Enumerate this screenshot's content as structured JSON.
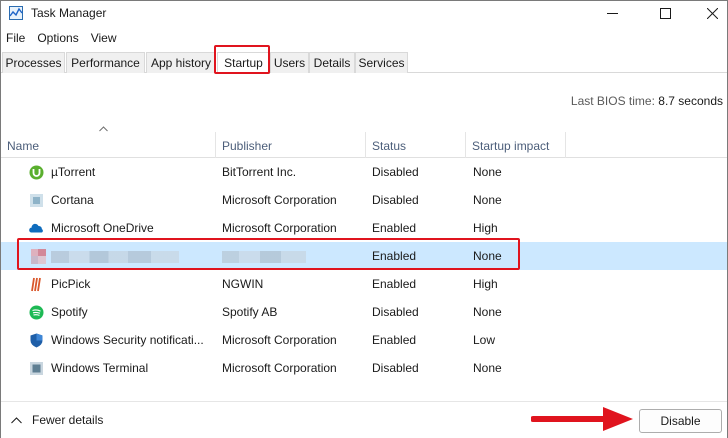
{
  "window": {
    "title": "Task Manager",
    "controls": {
      "minimize": "minimize-icon",
      "maximize": "maximize-icon",
      "close": "close-icon"
    }
  },
  "menu": [
    "File",
    "Options",
    "View"
  ],
  "tabs": [
    {
      "label": "Processes",
      "active": false
    },
    {
      "label": "Performance",
      "active": false
    },
    {
      "label": "App history",
      "active": false
    },
    {
      "label": "Startup",
      "active": true
    },
    {
      "label": "Users",
      "active": false
    },
    {
      "label": "Details",
      "active": false
    },
    {
      "label": "Services",
      "active": false
    }
  ],
  "bios": {
    "label": "Last BIOS time:",
    "value": "8.7 seconds"
  },
  "table": {
    "columns": [
      "Name",
      "Publisher",
      "Status",
      "Startup impact"
    ],
    "rows": [
      {
        "name": "µTorrent",
        "publisher": "BitTorrent Inc.",
        "status": "Disabled",
        "impact": "None",
        "icon": "utorrent-icon"
      },
      {
        "name": "Cortana",
        "publisher": "Microsoft Corporation",
        "status": "Disabled",
        "impact": "None",
        "icon": "cortana-icon"
      },
      {
        "name": "Microsoft OneDrive",
        "publisher": "Microsoft Corporation",
        "status": "Enabled",
        "impact": "High",
        "icon": "onedrive-icon"
      },
      {
        "name": "",
        "publisher": "",
        "status": "Enabled",
        "impact": "None",
        "icon": "blurred-app-icon",
        "selected": true,
        "redacted": true
      },
      {
        "name": "PicPick",
        "publisher": "NGWIN",
        "status": "Enabled",
        "impact": "High",
        "icon": "picpick-icon"
      },
      {
        "name": "Spotify",
        "publisher": "Spotify AB",
        "status": "Disabled",
        "impact": "None",
        "icon": "spotify-icon"
      },
      {
        "name": "Windows Security notificati...",
        "publisher": "Microsoft Corporation",
        "status": "Enabled",
        "impact": "Low",
        "icon": "windows-security-icon"
      },
      {
        "name": "Windows Terminal",
        "publisher": "Microsoft Corporation",
        "status": "Disabled",
        "impact": "None",
        "icon": "terminal-icon"
      }
    ]
  },
  "footer": {
    "fewer_details": "Fewer details",
    "disable_button": "Disable"
  },
  "colors": {
    "highlight_red": "#e0141e",
    "selection_blue": "#cce8ff",
    "header_text": "#4c5e7a"
  }
}
